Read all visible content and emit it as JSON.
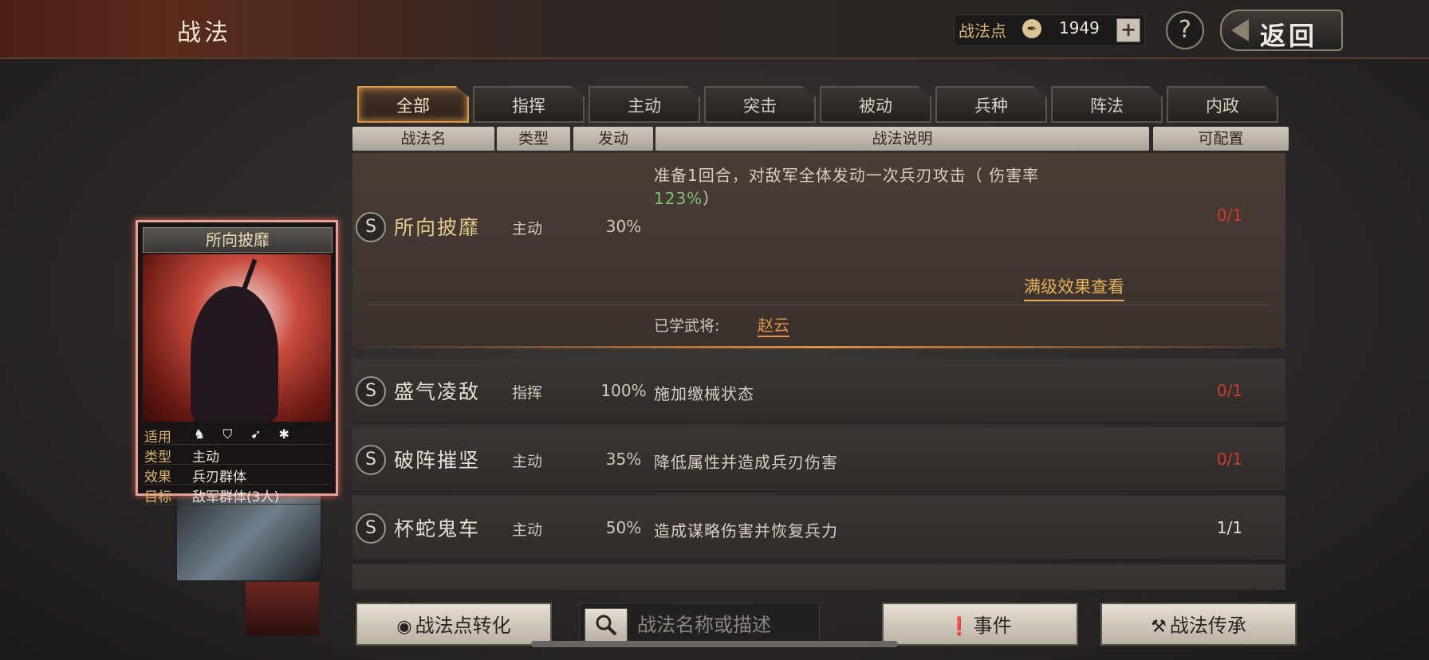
{
  "header": {
    "title": "战法",
    "points_label": "战法点",
    "points_icon": "ink-drop-icon",
    "points_value": "1949",
    "plus_label": "+",
    "help_label": "?",
    "back_label": "返回"
  },
  "tabs": [
    {
      "label": "全部",
      "active": true
    },
    {
      "label": "指挥",
      "active": false
    },
    {
      "label": "主动",
      "active": false
    },
    {
      "label": "突击",
      "active": false
    },
    {
      "label": "被动",
      "active": false
    },
    {
      "label": "兵种",
      "active": false
    },
    {
      "label": "阵法",
      "active": false
    },
    {
      "label": "内政",
      "active": false
    }
  ],
  "columns": [
    "战法名",
    "类型",
    "发动",
    "战法说明",
    "可配置"
  ],
  "expanded": {
    "badge": "S",
    "name": "所向披靡",
    "type": "主动",
    "rate": "30%",
    "desc_line1": "准备1回合，对敌军全体发动一次兵刃攻击（ 伤害率",
    "desc_rate": "123%",
    "desc_close": "）",
    "slots": "0/1",
    "max_link": "满级效果查看",
    "learned_label": "已学武将:",
    "learned_name": "赵云"
  },
  "rows": [
    {
      "badge": "S",
      "name": "盛气凌敌",
      "type": "指挥",
      "rate": "100%",
      "desc": "施加缴械状态",
      "slots": "0/1"
    },
    {
      "badge": "S",
      "name": "破阵摧坚",
      "type": "主动",
      "rate": "35%",
      "desc": "降低属性并造成兵刃伤害",
      "slots": "0/1"
    },
    {
      "badge": "S",
      "name": "杯蛇鬼车",
      "type": "主动",
      "rate": "50%",
      "desc": "造成谋略伤害并恢复兵力",
      "slots": "1/1"
    }
  ],
  "card": {
    "title": "所向披靡",
    "apply_key": "适用",
    "apply_icons": [
      "cavalry-icon",
      "shield-icon",
      "bow-icon",
      "siege-wheel-icon"
    ],
    "type_key": "类型",
    "type_val": "主动",
    "effect_key": "效果",
    "effect_val": "兵刃群体",
    "target_key": "目标",
    "target_val": "敌军群体(3人)"
  },
  "bottom": {
    "convert_label": "战法点转化",
    "search_placeholder": "战法名称或描述",
    "event_label": "事件",
    "inherit_label": "战法传承"
  },
  "colors": {
    "accent_gold": "#e3b25a",
    "slot_empty_red": "#d23a30",
    "rate_green": "#7fc07a"
  }
}
